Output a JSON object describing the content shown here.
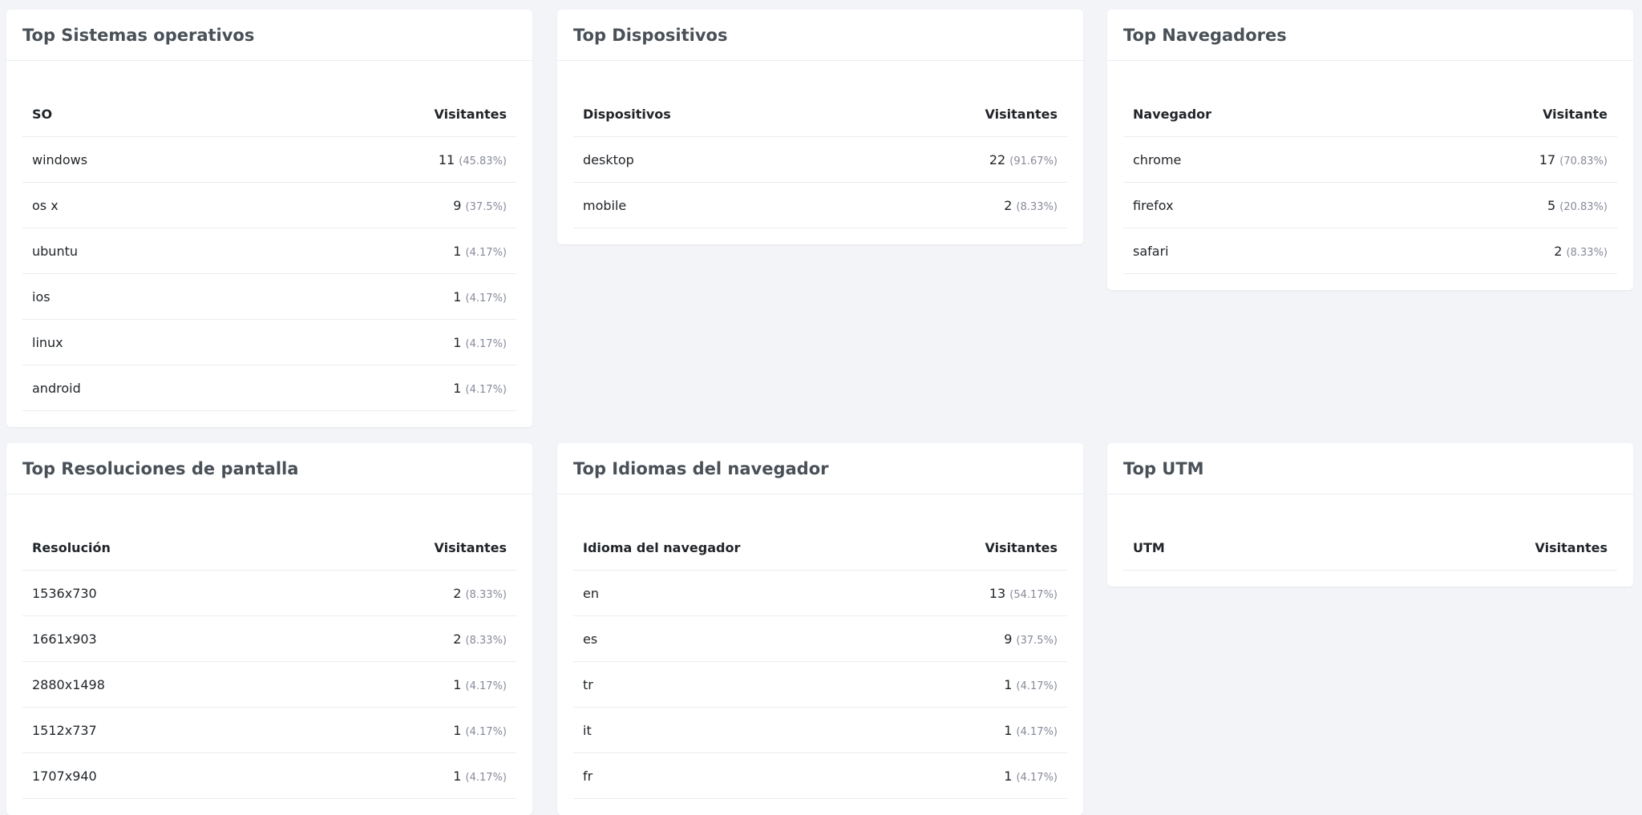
{
  "cards": [
    {
      "title": "Top Sistemas operativos",
      "col_label": "SO",
      "col_value": "Visitantes",
      "rows": [
        {
          "label": "windows",
          "count": "11",
          "pct": "(45.83%)"
        },
        {
          "label": "os x",
          "count": "9",
          "pct": "(37.5%)"
        },
        {
          "label": "ubuntu",
          "count": "1",
          "pct": "(4.17%)"
        },
        {
          "label": "ios",
          "count": "1",
          "pct": "(4.17%)"
        },
        {
          "label": "linux",
          "count": "1",
          "pct": "(4.17%)"
        },
        {
          "label": "android",
          "count": "1",
          "pct": "(4.17%)"
        }
      ]
    },
    {
      "title": "Top Dispositivos",
      "col_label": "Dispositivos",
      "col_value": "Visitantes",
      "rows": [
        {
          "label": "desktop",
          "count": "22",
          "pct": "(91.67%)"
        },
        {
          "label": "mobile",
          "count": "2",
          "pct": "(8.33%)"
        }
      ]
    },
    {
      "title": "Top Navegadores",
      "col_label": "Navegador",
      "col_value": "Visitante",
      "rows": [
        {
          "label": "chrome",
          "count": "17",
          "pct": "(70.83%)"
        },
        {
          "label": "firefox",
          "count": "5",
          "pct": "(20.83%)"
        },
        {
          "label": "safari",
          "count": "2",
          "pct": "(8.33%)"
        }
      ]
    },
    {
      "title": "Top Resoluciones de pantalla",
      "col_label": "Resolución",
      "col_value": "Visitantes",
      "rows": [
        {
          "label": "1536x730",
          "count": "2",
          "pct": "(8.33%)"
        },
        {
          "label": "1661x903",
          "count": "2",
          "pct": "(8.33%)"
        },
        {
          "label": "2880x1498",
          "count": "1",
          "pct": "(4.17%)"
        },
        {
          "label": "1512x737",
          "count": "1",
          "pct": "(4.17%)"
        },
        {
          "label": "1707x940",
          "count": "1",
          "pct": "(4.17%)"
        }
      ]
    },
    {
      "title": "Top Idiomas del navegador",
      "col_label": "Idioma del navegador",
      "col_value": "Visitantes",
      "rows": [
        {
          "label": "en",
          "count": "13",
          "pct": "(54.17%)"
        },
        {
          "label": "es",
          "count": "9",
          "pct": "(37.5%)"
        },
        {
          "label": "tr",
          "count": "1",
          "pct": "(4.17%)"
        },
        {
          "label": "it",
          "count": "1",
          "pct": "(4.17%)"
        },
        {
          "label": "fr",
          "count": "1",
          "pct": "(4.17%)"
        }
      ]
    },
    {
      "title": "Top UTM",
      "col_label": "UTM",
      "col_value": "Visitantes",
      "rows": []
    }
  ]
}
